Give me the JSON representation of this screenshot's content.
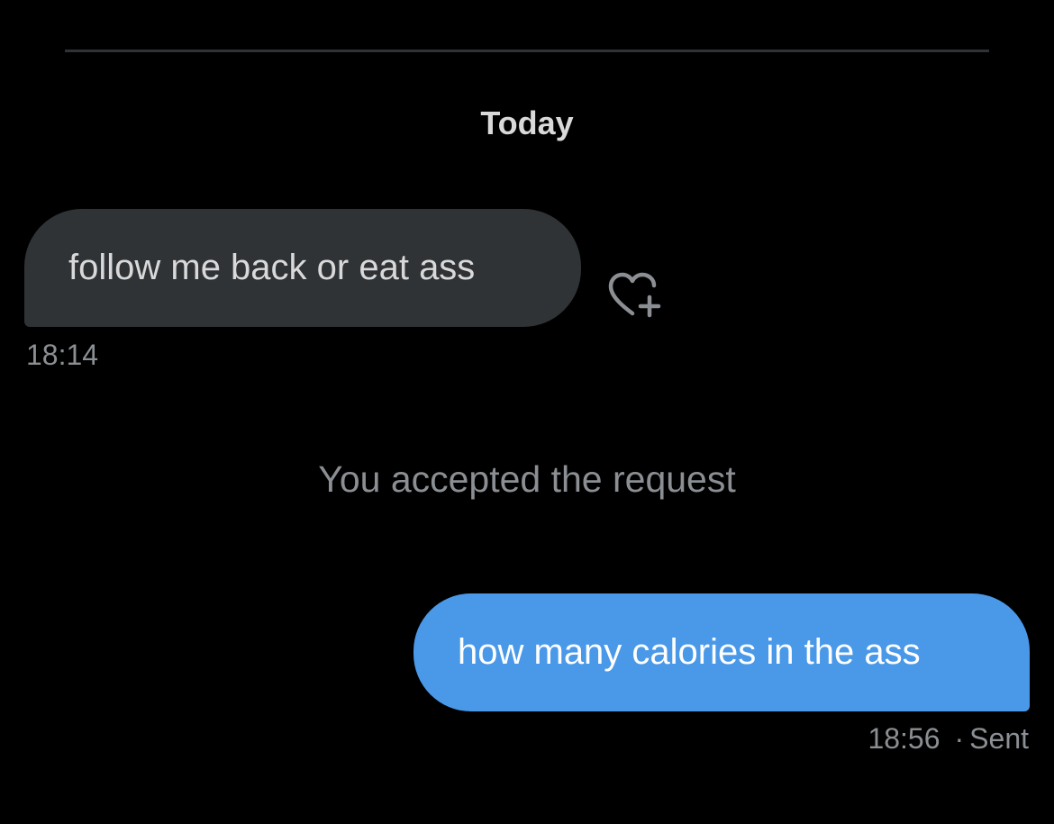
{
  "conversation": {
    "date_label": "Today",
    "messages": [
      {
        "direction": "received",
        "text": "follow me back or eat ass",
        "time": "18:14",
        "reaction_icon": "heart-plus-icon"
      },
      {
        "direction": "system",
        "text": "You accepted the request"
      },
      {
        "direction": "sent",
        "text": "how many calories in the ass",
        "time": "18:56",
        "separator": "·",
        "status": "Sent"
      }
    ]
  },
  "colors": {
    "background": "#000000",
    "received_bubble": "#2f3336",
    "sent_bubble": "#4a99e9",
    "muted_text": "#8b8f93",
    "primary_text": "#d9d9d9"
  }
}
